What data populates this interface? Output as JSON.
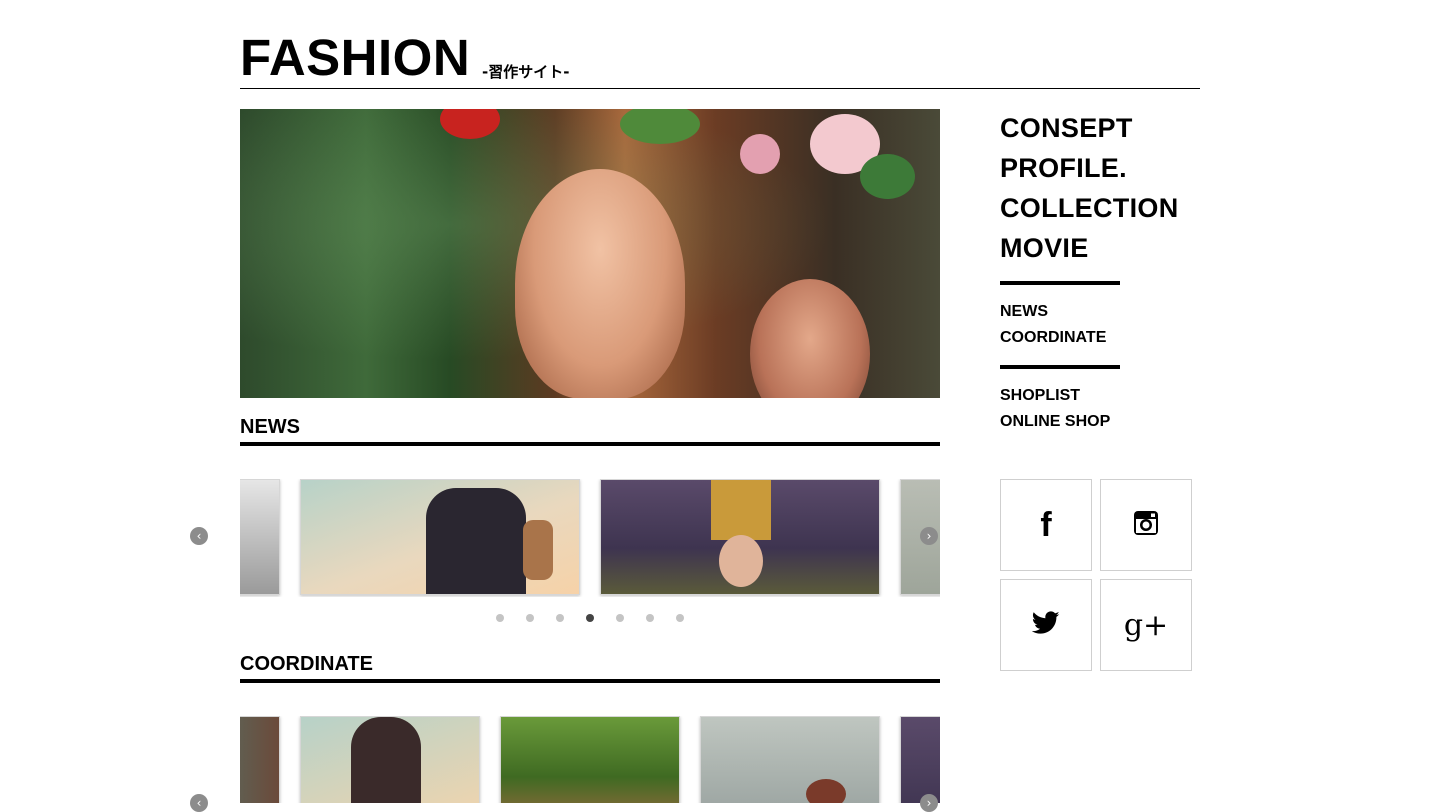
{
  "header": {
    "logo": "FASHION",
    "tagline": "-習作サイト-"
  },
  "sections": {
    "news_title": "NEWS",
    "coordinate_title": "COORDINATE"
  },
  "side_nav": {
    "main": [
      "CONSEPT",
      "PROFILE.",
      "COLLECTION",
      "MOVIE"
    ],
    "group1": [
      "NEWS",
      "COORDINATE"
    ],
    "group2": [
      "SHOPLIST",
      "ONLINE SHOP"
    ]
  },
  "social": {
    "facebook": "f",
    "google_plus": "g+"
  },
  "carousel_news": {
    "dots_total": 7,
    "active_dot": 4,
    "prev_symbol": "‹",
    "next_symbol": "›"
  },
  "colors": {
    "text": "#000000",
    "background": "#ffffff",
    "dot_inactive": "#c4c4c4",
    "dot_active": "#444444",
    "arrow": "#8c8c8c"
  }
}
